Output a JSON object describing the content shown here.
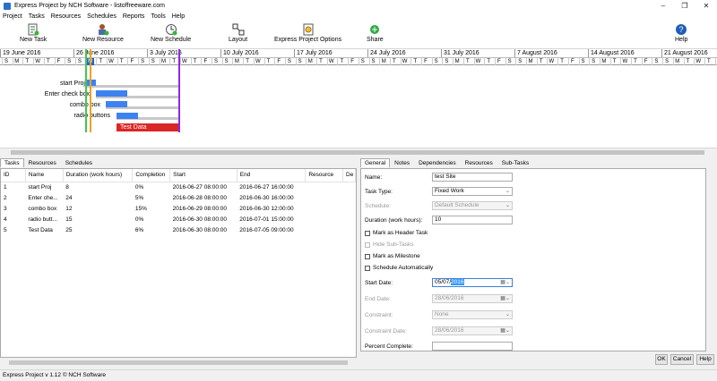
{
  "window": {
    "title": "Express Project by NCH Software - listoffreeware.com",
    "minimize": "–",
    "maximize": "❐",
    "close": "✕"
  },
  "menu": [
    "Project",
    "Tasks",
    "Resources",
    "Schedules",
    "Reports",
    "Tools",
    "Help"
  ],
  "toolbar": {
    "new_task": "New Task",
    "new_resource": "New Resource",
    "new_schedule": "New Schedule",
    "layout": "Layout",
    "project_options": "Express Project Options",
    "share": "Share",
    "help": "Help"
  },
  "gantt": {
    "weeks": [
      "19 June 2016",
      "26 June 2016",
      "3 July 2016",
      "10 July 2016",
      "17 July 2016",
      "24 July 2016",
      "31 July 2016",
      "7 August 2016",
      "14 August 2016",
      "21 August 2016"
    ],
    "day_letters": [
      "S",
      "M",
      "T",
      "W",
      "T",
      "F",
      "S"
    ],
    "selected_day": "M",
    "task_labels": [
      "start Proj",
      "Enter check box",
      "combo box",
      "radio buttons",
      "Test Data"
    ]
  },
  "left_tabs": [
    "Tasks",
    "Resources",
    "Schedules"
  ],
  "table": {
    "columns": [
      "ID",
      "Name",
      "Duration (work hours)",
      "Completion",
      "Start",
      "End",
      "Resource",
      "De"
    ],
    "rows": [
      [
        "1",
        "start Proj",
        "8",
        "0%",
        "2016-06-27 08:00:00",
        "2016-06-27 16:00:00",
        "",
        ""
      ],
      [
        "2",
        "Enter che...",
        "24",
        "5%",
        "2016-06-28 08:00:00",
        "2016-06-30 16:00:00",
        "",
        ""
      ],
      [
        "3",
        "combo box",
        "12",
        "15%",
        "2016-06-29 08:00:00",
        "2016-06-30 12:00:00",
        "",
        ""
      ],
      [
        "4",
        "radio butt...",
        "15",
        "0%",
        "2016-06-30 08:00:00",
        "2016-07-01 15:00:00",
        "",
        ""
      ],
      [
        "5",
        "Test Data",
        "25",
        "6%",
        "2016-06-30 08:00:00",
        "2016-07-05 09:00:00",
        "",
        ""
      ]
    ]
  },
  "right_tabs": [
    "General",
    "Notes",
    "Dependencies",
    "Resources",
    "Sub-Tasks"
  ],
  "form": {
    "name_label": "Name:",
    "name_value": "test Site",
    "task_type_label": "Task Type:",
    "task_type_value": "Fixed Work",
    "schedule_label": "Schedule:",
    "schedule_value": "Default Schedule",
    "duration_label": "Duration (work hours):",
    "duration_value": "10",
    "header_task": "Mark as Header Task",
    "hide_subtasks": "Hide Sub-Tasks",
    "milestone": "Mark as Milestone",
    "schedule_auto": "Schedule Automatically",
    "start_label": "Start Date:",
    "start_prefix": "05/07/",
    "start_selected": "2016",
    "end_label": "End Date:",
    "end_value": "28/06/2016",
    "constraint_label": "Constraint:",
    "constraint_value": "None",
    "constraint_date_label": "Constraint Date:",
    "constraint_date_value": "28/06/2016",
    "percent_label": "Percent Complete:",
    "percent_value": ""
  },
  "buttons": {
    "ok": "OK",
    "cancel": "Cancel",
    "help": "Help"
  },
  "status": "Express Project v 1.12 © NCH Software",
  "colors": {
    "bar": "#3c82f0",
    "test_bar": "#d92626",
    "line_green": "#3cc85a",
    "line_orange": "#f0a21e",
    "line_purple": "#8a2be2"
  }
}
